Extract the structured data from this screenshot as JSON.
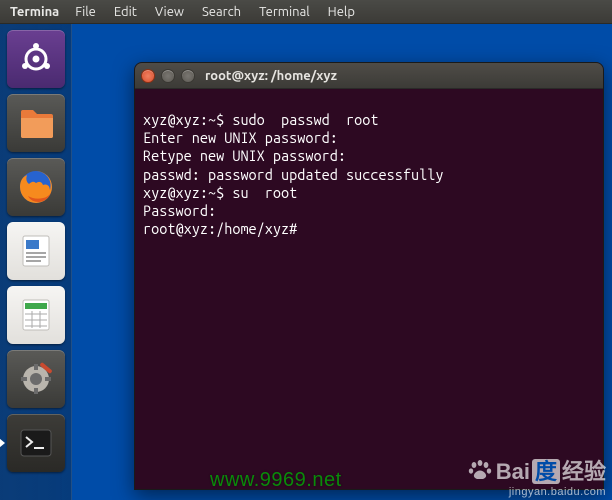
{
  "menubar": {
    "app": "Termina",
    "items": [
      "File",
      "Edit",
      "View",
      "Search",
      "Terminal",
      "Help"
    ]
  },
  "launcher": {
    "items": [
      {
        "name": "dash-icon",
        "fg": "#ffffff"
      },
      {
        "name": "files-icon"
      },
      {
        "name": "firefox-icon"
      },
      {
        "name": "writer-icon"
      },
      {
        "name": "calc-icon"
      },
      {
        "name": "settings-icon"
      },
      {
        "name": "terminal-icon",
        "active": true
      }
    ]
  },
  "terminal": {
    "title": "root@xyz: /home/xyz",
    "lines": [
      "xyz@xyz:~$ sudo  passwd  root",
      "Enter new UNIX password:",
      "Retype new UNIX password:",
      "passwd: password updated successfully",
      "xyz@xyz:~$ su  root",
      "Password:",
      "root@xyz:/home/xyz#"
    ]
  },
  "watermark": {
    "url": "www.9969.net",
    "brand_main": "Bai",
    "brand_cn": "经验",
    "brand_sub": "jingyan.baidu.com"
  }
}
